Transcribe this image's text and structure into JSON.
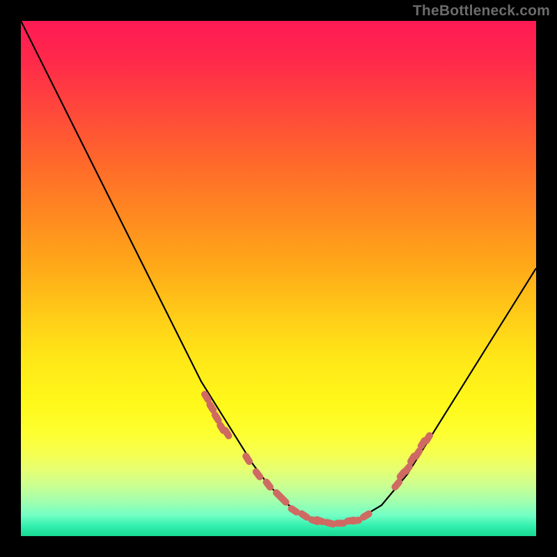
{
  "watermark": "TheBottleneck.com",
  "colors": {
    "background": "#000000",
    "curve": "#000000",
    "markers": "#cf6a63",
    "watermark_text": "#6b6b6b"
  },
  "chart_data": {
    "type": "line",
    "title": "",
    "xlabel": "",
    "ylabel": "",
    "xlim": [
      0,
      100
    ],
    "ylim": [
      0,
      100
    ],
    "grid": false,
    "series": [
      {
        "name": "bottleneck-curve",
        "x": [
          0,
          5,
          10,
          15,
          20,
          25,
          30,
          35,
          40,
          45,
          48,
          50,
          52,
          55,
          58,
          60,
          62,
          65,
          70,
          75,
          80,
          85,
          90,
          95,
          100
        ],
        "values": [
          100,
          90,
          80,
          70,
          60,
          50,
          40,
          30,
          22,
          14,
          10,
          8,
          6,
          4,
          3,
          2.5,
          2.5,
          3,
          6,
          12,
          20,
          28,
          36,
          44,
          52
        ]
      }
    ],
    "markers": {
      "name": "highlighted-points",
      "x": [
        36,
        37,
        38,
        39,
        40,
        44,
        46,
        48,
        50,
        51,
        53,
        55,
        57,
        58,
        60,
        62,
        64,
        65,
        67,
        73,
        74,
        75,
        76,
        77,
        78,
        79
      ],
      "values": [
        27,
        25,
        23,
        21,
        20,
        15,
        12,
        10,
        8,
        7,
        5,
        4,
        3,
        3,
        2.5,
        2.5,
        3,
        3,
        4,
        10,
        12,
        13,
        15,
        16,
        18,
        19
      ]
    }
  }
}
